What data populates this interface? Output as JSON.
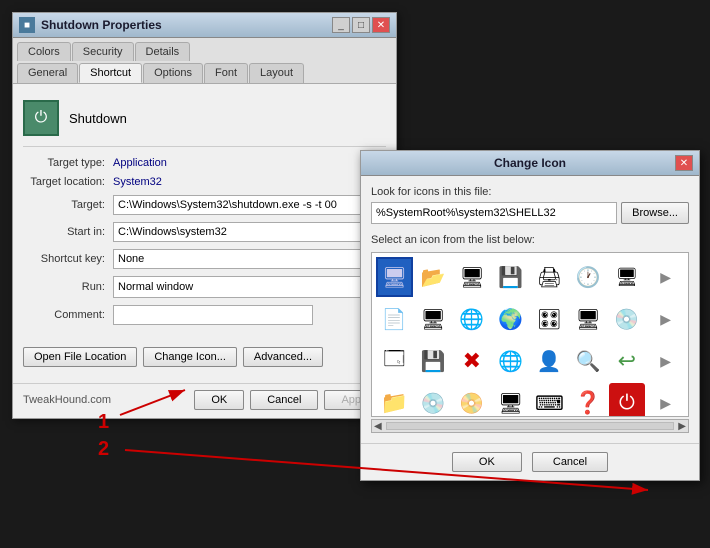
{
  "shutdown_dialog": {
    "title": "Shutdown Properties",
    "tabs": {
      "row1": [
        "Colors",
        "Security",
        "Details"
      ],
      "row2_items": [
        {
          "label": "General",
          "active": false
        },
        {
          "label": "Shortcut",
          "active": true
        },
        {
          "label": "Options",
          "active": false
        },
        {
          "label": "Font",
          "active": false
        },
        {
          "label": "Layout",
          "active": false
        }
      ]
    },
    "shortcut_name": "Shutdown",
    "properties": {
      "target_type_label": "Target type:",
      "target_type_value": "Application",
      "target_location_label": "Target location:",
      "target_location_value": "System32",
      "target_label": "Target:",
      "target_value": "C:\\Windows\\System32\\shutdown.exe -s -t 00",
      "start_in_label": "Start in:",
      "start_in_value": "C:\\Windows\\system32",
      "shortcut_key_label": "Shortcut key:",
      "shortcut_key_value": "None",
      "run_label": "Run:",
      "run_value": "Normal window",
      "comment_label": "Comment:"
    },
    "buttons": {
      "open_location": "Open File Location",
      "change_icon": "Change Icon...",
      "advanced": "Advanced..."
    },
    "footer": {
      "brand": "TweakHound.com",
      "ok": "OK",
      "cancel": "Cancel",
      "apply": "Apply"
    }
  },
  "change_icon_dialog": {
    "title": "Change Icon",
    "file_label": "Look for icons in this file:",
    "file_value": "%SystemRoot%\\system32\\SHELL32",
    "browse_label": "Browse...",
    "icons_label": "Select an icon from the list below:",
    "footer": {
      "ok": "OK",
      "cancel": "Cancel"
    }
  },
  "annotations": {
    "number1": "1",
    "number2": "2"
  }
}
